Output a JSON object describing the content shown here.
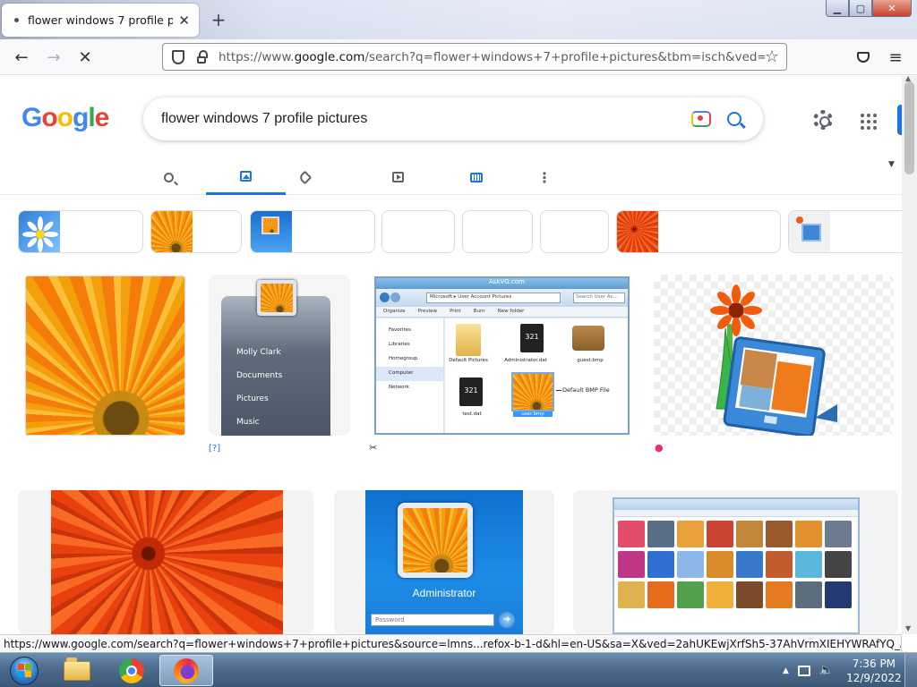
{
  "browser": {
    "tab_title": "flower windows 7 profile pictur",
    "tab_close": "✕",
    "new_tab": "+",
    "url_prefix": "https://www.",
    "url_host": "google.com",
    "url_rest": "/search?q=flower+windows+7+profile+pictures&tbm=isch&ved=2ahUKE",
    "back": "←",
    "forward": "→",
    "stop": "✕",
    "bookmark_star": "☆",
    "window_min": "▁",
    "window_max": "▢",
    "window_close": "✕",
    "menu": "≡"
  },
  "google": {
    "logo_letters": [
      {
        "ch": "G",
        "color": "#4285f4"
      },
      {
        "ch": "o",
        "color": "#ea4335"
      },
      {
        "ch": "o",
        "color": "#fbbc05"
      },
      {
        "ch": "g",
        "color": "#4285f4"
      },
      {
        "ch": "l",
        "color": "#34a853"
      },
      {
        "ch": "e",
        "color": "#ea4335"
      }
    ],
    "query": "flower windows 7 profile pictures",
    "tabs": [
      "search-icon",
      "image-icon",
      "tag-icon",
      "video-icon",
      "news-icon",
      "more-vert-icon"
    ],
    "active_tab": "image-icon",
    "accent": "#1a73e8"
  },
  "results": {
    "startmenu_users": [
      "Molly Clark",
      "Documents",
      "Pictures",
      "Music"
    ],
    "explorer": {
      "site": "AskVG.com",
      "crumbs": [
        "Microsoft",
        "User Account Pictures"
      ],
      "search_placeholder": "Search User Ac...",
      "toolbar": [
        "Organize",
        "Preview",
        "Print",
        "Burn",
        "New folder"
      ],
      "nav": [
        "Favorites",
        "Libraries",
        "Homegroup",
        "Computer",
        "Network"
      ],
      "files": [
        "Default Pictures",
        "Administrator.dat",
        "guest.bmp",
        "test.dat",
        "user.bmp"
      ],
      "callout": "Default BMP File"
    },
    "login_user": "Administrator",
    "login_placeholder": "Password"
  },
  "status_url": "https://www.google.com/search?q=flower+windows+7+profile+pictures&source=lmns...refox-b-1-d&hl=en-US&sa=X&ved=2ahUKEwjXrfSh5-37AhVrmXIEHYWRAfYQ_AUoBHoECAEQBA",
  "taskbar": {
    "time": "7:36 PM",
    "date": "12/9/2022"
  }
}
